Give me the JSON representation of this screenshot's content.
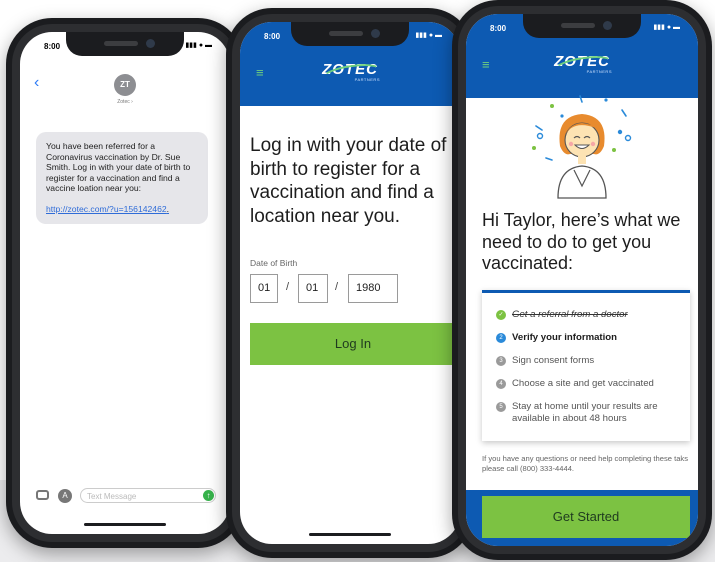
{
  "phone1": {
    "time": "8:00",
    "status_icons": "▮▮▮ ● ▬",
    "avatar_initials": "ZT",
    "contact_name": "Zotec ›",
    "message_text": "You have been referred for a Coronavirus vaccination by Dr. Sue Smith. Log in with your date of birth to register for a vaccination and find a vaccine loation near you:",
    "message_link": "http://zotec.com/?u=156142462",
    "message_link_suffix": ".",
    "composer_placeholder": "Text Message"
  },
  "phone2": {
    "time": "8:00",
    "status_icons": "▮▮▮ ● ▬",
    "logo_word": "ZOTEC",
    "logo_sub": "PARTNERS",
    "heading": "Log in with your date of birth to register for a vaccination and find a location near you.",
    "dob_label": "Date of Birth",
    "dob_month": "01",
    "dob_day": "01",
    "dob_year": "1980",
    "separator": "/",
    "login_label": "Log In"
  },
  "phone3": {
    "time": "8:00",
    "status_icons": "▮▮▮ ● ▬",
    "logo_word": "ZOTEC",
    "logo_sub": "PARTNERS",
    "heading": "Hi Taylor, here’s what we need to do to get you vaccinated:",
    "steps": [
      {
        "num": "✓",
        "label": "Get a referral from a doctor"
      },
      {
        "num": "2",
        "label": "Verify your information"
      },
      {
        "num": "3",
        "label": "Sign consent forms"
      },
      {
        "num": "4",
        "label": "Choose a site and get vaccinated"
      },
      {
        "num": "5",
        "label": "Stay at home until your results are available in about 48 hours"
      }
    ],
    "help_text": "If you have any questions or need help completing these taks please call (800) 333-4444.",
    "start_label": "Get Started"
  },
  "colors": {
    "brand_blue": "#0d5ab2",
    "accent_green": "#7cc242",
    "link_blue": "#2f6cd8"
  }
}
